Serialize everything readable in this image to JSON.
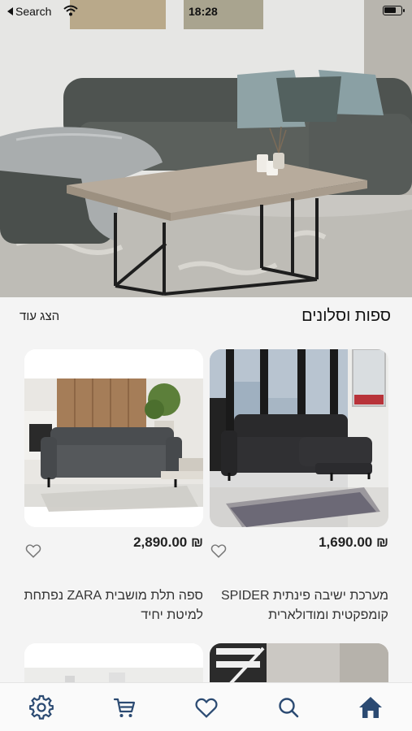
{
  "status_bar": {
    "back_label": "Search",
    "time": "18:28"
  },
  "hero": {
    "image_subject": "living-room-sofa-with-coffee-table"
  },
  "section": {
    "title": "ספות וסלונים",
    "show_more": "הצג עוד"
  },
  "products": [
    {
      "price": "1,690.00 ₪",
      "name": "מערכת ישיבה פינתית SPIDER קומפקטית ומודולארית",
      "favorite": false
    },
    {
      "price": "2,890.00 ₪",
      "name": "ספה תלת מושבית ZARA נפתחת למיטת יחיד",
      "favorite": false
    }
  ],
  "bottom_nav": {
    "items": [
      "settings-icon",
      "cart-icon",
      "heart-icon",
      "search-icon",
      "home-icon"
    ],
    "active": "home-icon",
    "active_color": "#2b4a72",
    "icon_color": "#2b4a72"
  }
}
